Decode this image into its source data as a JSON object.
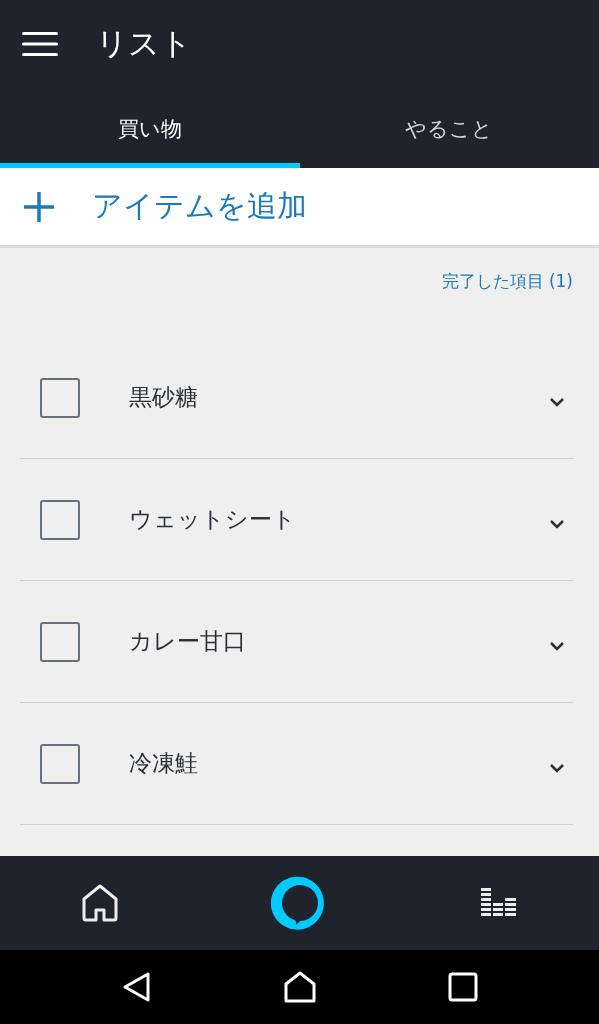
{
  "header": {
    "title": "リスト"
  },
  "tabs": [
    {
      "label": "買い物",
      "selected": true
    },
    {
      "label": "やること",
      "selected": false
    }
  ],
  "add_item": {
    "label": "アイテムを追加"
  },
  "completed_link": "完了した項目 (1)",
  "items": [
    {
      "name": "黒砂糖",
      "checked": false
    },
    {
      "name": "ウェットシート",
      "checked": false
    },
    {
      "name": "カレー甘口",
      "checked": false
    },
    {
      "name": "冷凍鮭",
      "checked": false
    }
  ],
  "bottom_nav": [
    {
      "kind": "home",
      "selected": false
    },
    {
      "kind": "alexa",
      "selected": true
    },
    {
      "kind": "music",
      "selected": false
    }
  ],
  "system_nav": [
    {
      "kind": "back"
    },
    {
      "kind": "home"
    },
    {
      "kind": "recents"
    }
  ]
}
